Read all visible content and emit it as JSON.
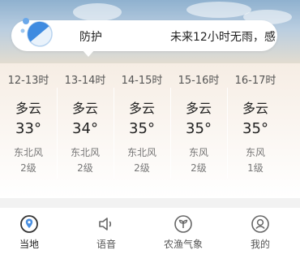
{
  "tip": {
    "title": "防护",
    "text": "未来12小时无雨，感"
  },
  "hourly": [
    {
      "hour": "12-13时",
      "condition": "多云",
      "temp": "33°",
      "wind_dir": "东北风",
      "wind_level": "2级"
    },
    {
      "hour": "13-14时",
      "condition": "多云",
      "temp": "34°",
      "wind_dir": "东北风",
      "wind_level": "2级"
    },
    {
      "hour": "14-15时",
      "condition": "多云",
      "temp": "35°",
      "wind_dir": "东北风",
      "wind_level": "2级"
    },
    {
      "hour": "15-16时",
      "condition": "多云",
      "temp": "35°",
      "wind_dir": "东风",
      "wind_level": "2级"
    },
    {
      "hour": "16-17时",
      "condition": "多云",
      "temp": "35°",
      "wind_dir": "东风",
      "wind_level": "1级"
    }
  ],
  "nav": {
    "items": [
      {
        "label": "当地",
        "icon": "location-pin-icon",
        "active": true
      },
      {
        "label": "语音",
        "icon": "speaker-icon",
        "active": false
      },
      {
        "label": "农渔气象",
        "icon": "sprout-icon",
        "active": false
      },
      {
        "label": "我的",
        "icon": "profile-icon",
        "active": false
      }
    ]
  },
  "colors": {
    "sky_top": "#8fb1cf",
    "panel_bg": "#f6ede4",
    "pill_blue": "#4a90e2",
    "active_icon": "#333333"
  }
}
